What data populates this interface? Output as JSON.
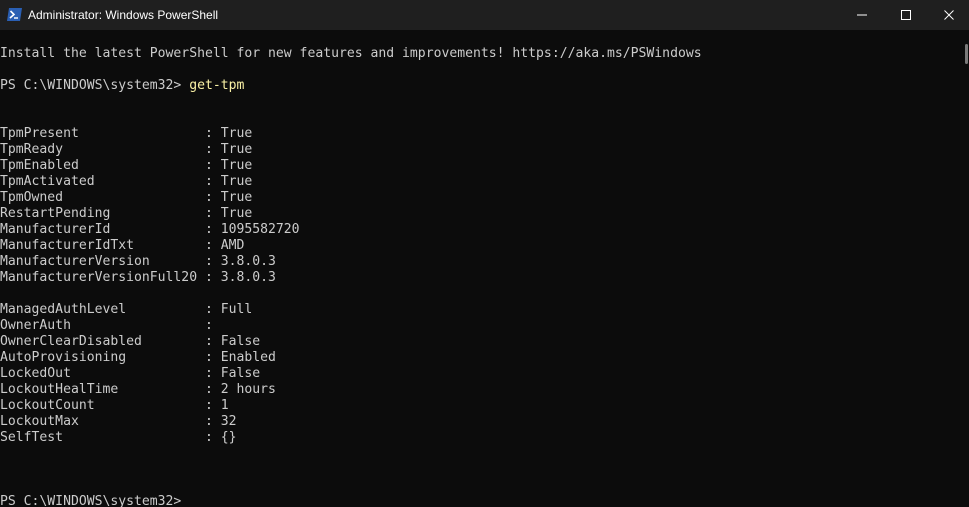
{
  "window": {
    "title": "Administrator: Windows PowerShell",
    "icon": "powershell-icon",
    "minimize_icon": "minimize-icon",
    "maximize_icon": "maximize-icon",
    "close_icon": "close-icon"
  },
  "colors": {
    "background": "#0c0c0c",
    "titlebar": "#1f1f1f",
    "text": "#cccccc",
    "command": "#f9f1a5"
  },
  "console": {
    "banner": "Install the latest PowerShell for new features and improvements! https://aka.ms/PSWindows",
    "prompt1": "PS C:\\WINDOWS\\system32> ",
    "command1": "get-tpm",
    "group1": [
      "TpmPresent                : True",
      "TpmReady                  : True",
      "TpmEnabled                : True",
      "TpmActivated              : True",
      "TpmOwned                  : True",
      "RestartPending            : True",
      "ManufacturerId            : 1095582720",
      "ManufacturerIdTxt         : AMD",
      "ManufacturerVersion       : 3.8.0.3",
      "ManufacturerVersionFull20 : 3.8.0.3"
    ],
    "group2": [
      "ManagedAuthLevel          : Full",
      "OwnerAuth                 :",
      "OwnerClearDisabled        : False",
      "AutoProvisioning          : Enabled",
      "LockedOut                 : False",
      "LockoutHealTime           : 2 hours",
      "LockoutCount              : 1",
      "LockoutMax                : 32",
      "SelfTest                  : {}"
    ],
    "prompt2": "PS C:\\WINDOWS\\system32>"
  }
}
